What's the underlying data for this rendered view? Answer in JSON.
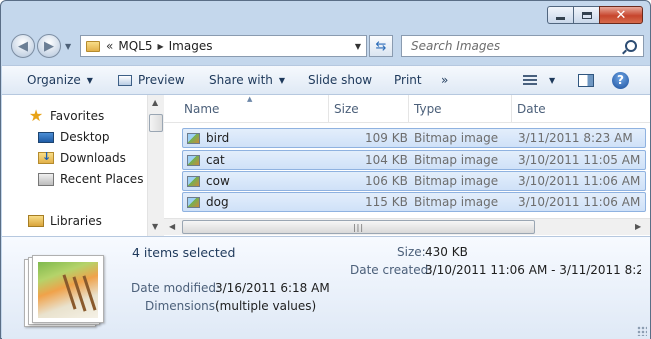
{
  "window": {
    "caption_buttons": {
      "minimize_icon": "minimize-icon",
      "maximize_icon": "maximize-icon",
      "close_glyph": "✕"
    }
  },
  "nav": {
    "back_icon": "back-arrow-icon",
    "forward_icon": "forward-arrow-icon",
    "breadcrumb": {
      "overflow": "«",
      "segments": [
        "MQL5",
        "Images"
      ]
    },
    "search_placeholder": "Search Images"
  },
  "toolbar": {
    "organize": "Organize",
    "preview": "Preview",
    "share_with": "Share with",
    "slide_show": "Slide show",
    "print": "Print",
    "more": "»"
  },
  "navpane": {
    "items": [
      {
        "label": "Favorites",
        "icon": "star-icon"
      },
      {
        "label": "Desktop",
        "icon": "desktop-icon"
      },
      {
        "label": "Downloads",
        "icon": "downloads-folder-icon"
      },
      {
        "label": "Recent Places",
        "icon": "recent-places-icon"
      },
      {
        "label": "Libraries",
        "icon": "libraries-icon"
      }
    ]
  },
  "files": {
    "columns": {
      "name": "Name",
      "size": "Size",
      "type": "Type",
      "date": "Date"
    },
    "rows": [
      {
        "name": "bird",
        "size": "109 KB",
        "type": "Bitmap image",
        "date": "3/11/2011 8:23 AM"
      },
      {
        "name": "cat",
        "size": "104 KB",
        "type": "Bitmap image",
        "date": "3/10/2011 11:05 AM"
      },
      {
        "name": "cow",
        "size": "106 KB",
        "type": "Bitmap image",
        "date": "3/10/2011 11:06 AM"
      },
      {
        "name": "dog",
        "size": "115 KB",
        "type": "Bitmap image",
        "date": "3/10/2011 11:06 AM"
      }
    ],
    "hscroll_grip": "|||"
  },
  "details": {
    "selection": "4 items selected",
    "date_modified_label": "Date modified:",
    "date_modified": "3/16/2011 6:18 AM",
    "dimensions_label": "Dimensions:",
    "dimensions": "(multiple values)",
    "size_label": "Size:",
    "size": "430 KB",
    "date_created_label": "Date created:",
    "date_created": "3/10/2011 11:06 AM - 3/11/2011 8:23 ..."
  }
}
